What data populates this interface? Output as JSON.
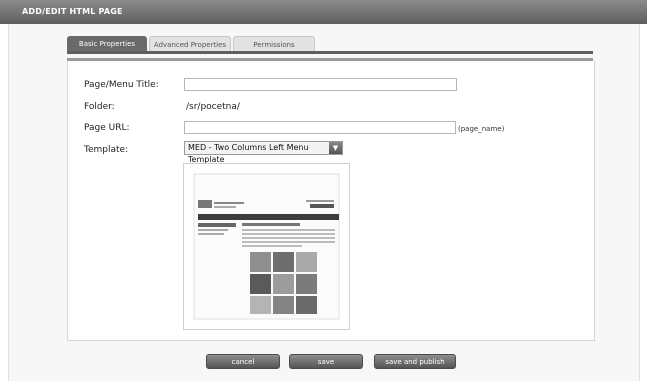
{
  "window": {
    "title": "ADD/EDIT HTML PAGE"
  },
  "tabs": [
    {
      "label": "Basic Properties",
      "active": true
    },
    {
      "label": "Advanced Properties",
      "active": false
    },
    {
      "label": "Permissions",
      "active": false
    }
  ],
  "form": {
    "page_title": {
      "label": "Page/Menu Title:",
      "value": ""
    },
    "folder": {
      "label": "Folder:",
      "value": "/sr/pocetna/"
    },
    "page_url": {
      "label": "Page URL:",
      "value": "",
      "hint": "(page_name)"
    },
    "template": {
      "label": "Template:",
      "selected": "MED - Two Columns Left Menu Template"
    }
  },
  "buttons": {
    "cancel": "cancel",
    "save": "save",
    "save_publish": "save and publish"
  },
  "colors": {
    "titlebar": "#6f6f6f",
    "button": "#6b6b6b",
    "tab_active": "#6a6a6a"
  }
}
